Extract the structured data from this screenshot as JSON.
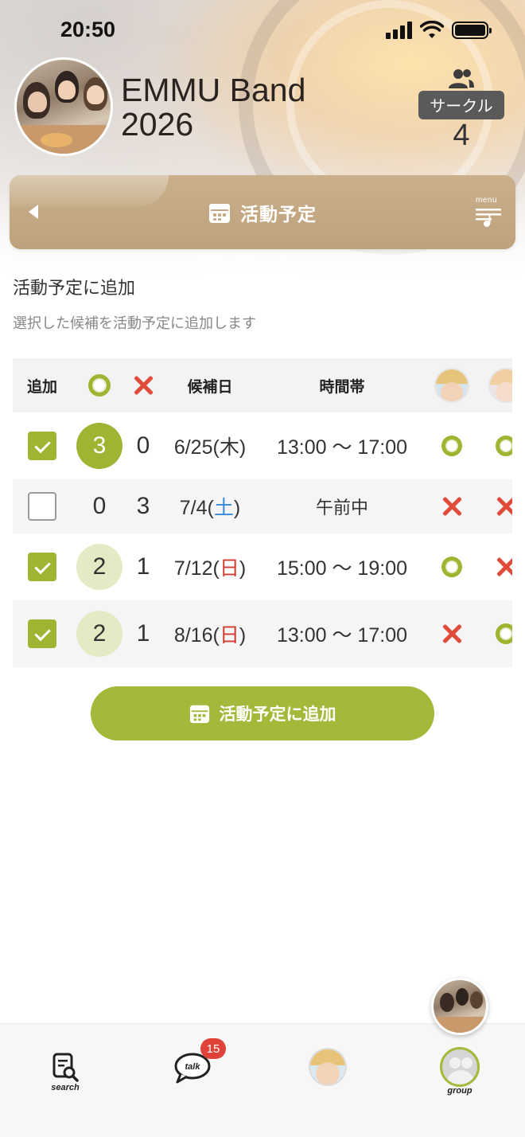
{
  "status_bar": {
    "time": "20:50"
  },
  "group": {
    "name": "EMMU Band\n2026",
    "badge": "サークル",
    "member_count": "4"
  },
  "title_bar": {
    "title": "活動予定",
    "menu_label": "menu"
  },
  "section": {
    "title": "活動予定に追加",
    "description": "選択した候補を活動予定に追加します"
  },
  "table": {
    "headers": {
      "add": "追加",
      "date": "候補日",
      "time": "時間帯"
    },
    "rows": [
      {
        "checked": true,
        "ok": "3",
        "ng": "0",
        "date": "6/25(",
        "dow": "木",
        "close": ")",
        "time": "13:00 〜 17:00",
        "member1": "ok",
        "member2": "ok"
      },
      {
        "checked": false,
        "ok": "0",
        "ng": "3",
        "date": "7/4(",
        "dow": "土",
        "close": ")",
        "time": "午前中",
        "member1": "ng",
        "member2": "ng"
      },
      {
        "checked": true,
        "ok": "2",
        "ng": "1",
        "date": "7/12(",
        "dow": "日",
        "close": ")",
        "time": "15:00 〜 19:00",
        "member1": "ok",
        "member2": "ng"
      },
      {
        "checked": true,
        "ok": "2",
        "ng": "1",
        "date": "8/16(",
        "dow": "日",
        "close": ")",
        "time": "13:00 〜 17:00",
        "member1": "ng",
        "member2": "ok"
      }
    ]
  },
  "add_button": {
    "label": "活動予定に追加"
  },
  "bottom_nav": {
    "search_label": "search",
    "talk_label": "talk",
    "talk_badge": "15",
    "group_label": "group"
  },
  "colors": {
    "accent_green": "#9db532",
    "title_bar": "#c4a982",
    "ng_red": "#e04b3a",
    "saturday_blue": "#3b8ad8",
    "sunday_red": "#d23b2f"
  }
}
